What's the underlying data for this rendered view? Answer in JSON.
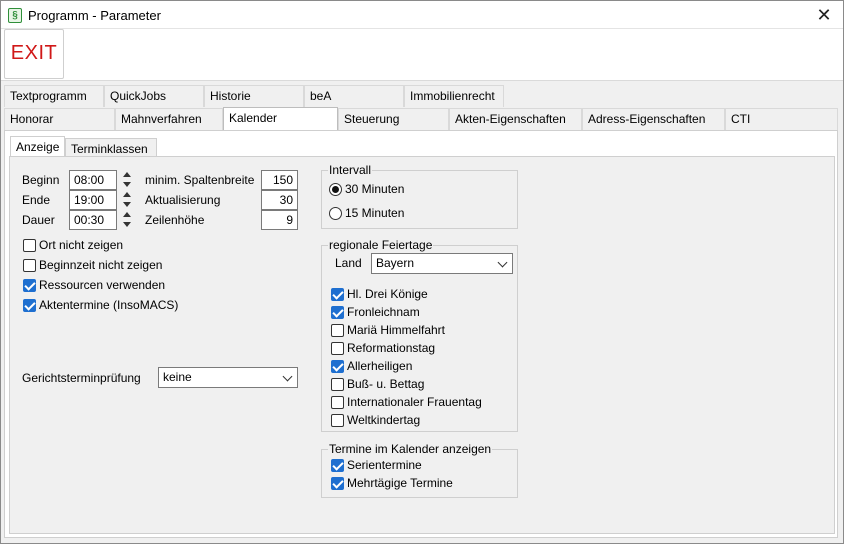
{
  "window": {
    "title": "Programm - Parameter",
    "close_glyph": "✕",
    "app_icon_glyph": "§"
  },
  "toolbar": {
    "exit_label": "EXIT"
  },
  "tabs_row1": [
    "Textprogramm",
    "QuickJobs",
    "Historie",
    "beA",
    "Immobilienrecht"
  ],
  "tabs_row2": [
    "Honorar",
    "Mahnverfahren",
    "Kalender",
    "Steuerung",
    "Akten-Eigenschaften",
    "Adress-Eigenschaften",
    "CTI"
  ],
  "subtabs": [
    "Anzeige",
    "Terminklassen"
  ],
  "anzeige": {
    "beginn_label": "Beginn",
    "beginn_value": "08:00",
    "ende_label": "Ende",
    "ende_value": "19:00",
    "dauer_label": "Dauer",
    "dauer_value": "00:30",
    "spaltenbreite_label": "minim. Spaltenbreite",
    "spaltenbreite_value": "150",
    "aktualisierung_label": "Aktualisierung",
    "aktualisierung_value": "30",
    "zeilenhoehe_label": "Zeilenhöhe",
    "zeilenhoehe_value": "9",
    "checkboxes": [
      {
        "label": "Ort nicht zeigen",
        "checked": false
      },
      {
        "label": "Beginnzeit nicht zeigen",
        "checked": false
      },
      {
        "label": "Ressourcen verwenden",
        "checked": true
      },
      {
        "label": "Aktentermine (InsoMACS)",
        "checked": true
      }
    ],
    "gerichtstermin_label": "Gerichtsterminprüfung",
    "gerichtstermin_value": "keine"
  },
  "intervall": {
    "title": "Intervall",
    "options": [
      {
        "label": "30 Minuten",
        "checked": true
      },
      {
        "label": "15 Minuten",
        "checked": false
      }
    ]
  },
  "feiertage": {
    "title": "regionale Feiertage",
    "land_label": "Land",
    "land_value": "Bayern",
    "items": [
      {
        "label": "Hl. Drei Könige",
        "checked": true
      },
      {
        "label": "Fronleichnam",
        "checked": true
      },
      {
        "label": "Mariä Himmelfahrt",
        "checked": false
      },
      {
        "label": "Reformationstag",
        "checked": false
      },
      {
        "label": "Allerheiligen",
        "checked": true
      },
      {
        "label": "Buß- u. Bettag",
        "checked": false
      },
      {
        "label": "Internationaler Frauentag",
        "checked": false
      },
      {
        "label": "Weltkindertag",
        "checked": false
      }
    ]
  },
  "termine_anzeigen": {
    "title": "Termine im Kalender anzeigen",
    "items": [
      {
        "label": "Serientermine",
        "checked": true
      },
      {
        "label": "Mehrtägige Termine",
        "checked": true
      }
    ]
  },
  "colors": {
    "accent": "#1e6fd0",
    "exit_red": "#d01818"
  }
}
